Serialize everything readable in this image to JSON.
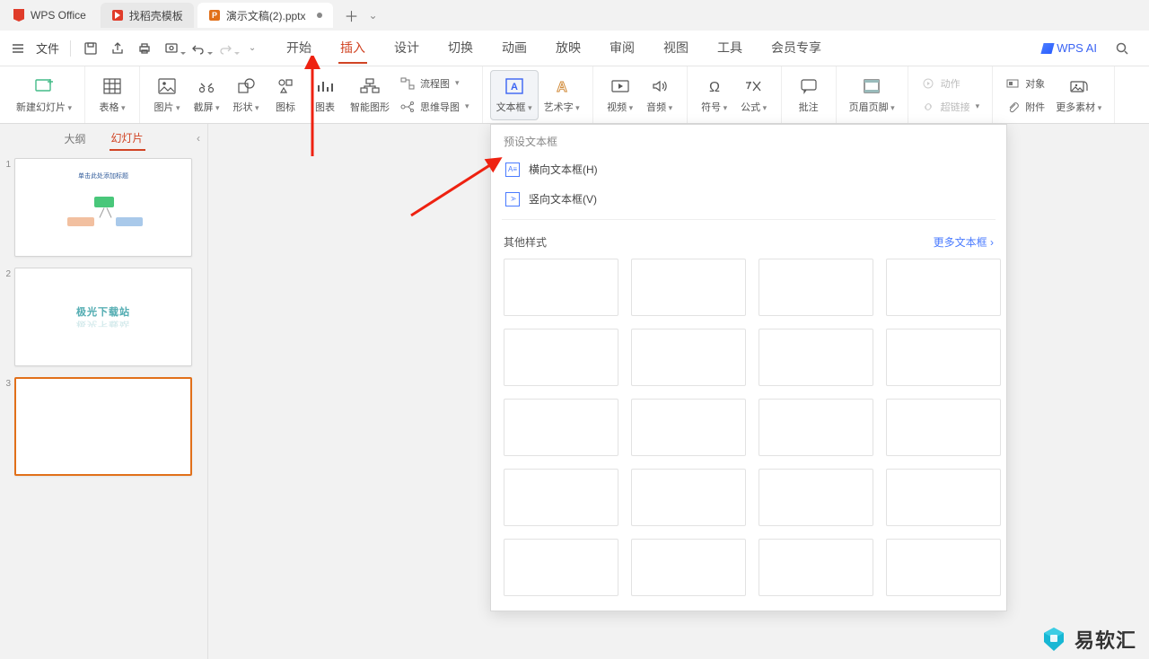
{
  "tabs": {
    "home": "WPS Office",
    "template": "找稻壳模板",
    "doc": "演示文稿(2).pptx"
  },
  "menu": {
    "file": "文件",
    "tabs": [
      "开始",
      "插入",
      "设计",
      "切换",
      "动画",
      "放映",
      "审阅",
      "视图",
      "工具",
      "会员专享"
    ],
    "active": "插入",
    "wpsai": "WPS AI"
  },
  "ribbon": {
    "newslide": "新建幻灯片",
    "table": "表格",
    "picture": "图片",
    "screenshot": "截屏",
    "shape": "形状",
    "icon": "图标",
    "chart": "图表",
    "smartart": "智能图形",
    "flowchart": "流程图",
    "mindmap": "思维导图",
    "textbox": "文本框",
    "wordart": "艺术字",
    "video": "视频",
    "audio": "音频",
    "symbol": "符号",
    "equation": "公式",
    "comment": "批注",
    "headerfooter": "页眉页脚",
    "action": "动作",
    "hyperlink": "超链接",
    "object": "对象",
    "attachment": "附件",
    "moreassets": "更多素材"
  },
  "sidepanel": {
    "outline": "大纲",
    "slides": "幻灯片",
    "t2text": "极光下载站"
  },
  "popup": {
    "preset": "预设文本框",
    "horizontal": "横向文本框(H)",
    "vertical": "竖向文本框(V)",
    "other": "其他样式",
    "more": "更多文本框"
  },
  "slides": [
    "1",
    "2",
    "3"
  ],
  "watermark": "易软汇"
}
